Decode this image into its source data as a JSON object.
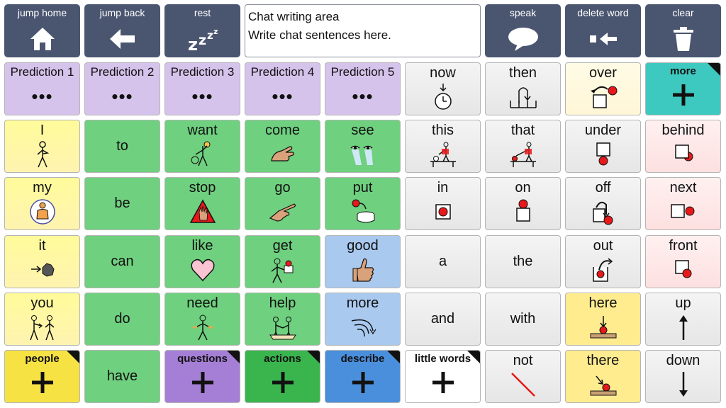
{
  "top": {
    "jump_home": "jump home",
    "jump_back": "jump back",
    "rest": "rest",
    "speak": "speak",
    "delete_word": "delete word",
    "clear": "clear"
  },
  "chat": {
    "title": "Chat writing area",
    "hint": "Write chat sentences here."
  },
  "predictions": [
    "Prediction 1",
    "Prediction 2",
    "Prediction 3",
    "Prediction 4",
    "Prediction 5"
  ],
  "prediction_dots": "•••",
  "words": {
    "now": "now",
    "then": "then",
    "over": "over",
    "more_cat": "more",
    "I": "I",
    "to": "to",
    "want": "want",
    "come": "come",
    "see": "see",
    "this": "this",
    "that": "that",
    "under": "under",
    "behind": "behind",
    "my": "my",
    "be": "be",
    "stop": "stop",
    "go": "go",
    "put": "put",
    "in": "in",
    "on": "on",
    "off": "off",
    "next": "next",
    "it": "it",
    "can": "can",
    "like": "like",
    "get": "get",
    "good": "good",
    "a": "a",
    "the": "the",
    "out": "out",
    "front": "front",
    "you": "you",
    "do": "do",
    "need": "need",
    "help": "help",
    "more": "more",
    "and": "and",
    "with": "with",
    "here": "here",
    "up": "up",
    "have": "have",
    "not": "not",
    "there": "there",
    "down": "down"
  },
  "categories": {
    "people": "people",
    "questions": "questions",
    "actions": "actions",
    "describe": "describe",
    "little_words": "little words"
  },
  "colors": {
    "top_button": "#4a5570",
    "core_yellow": "#fff6a0",
    "verb_green": "#6fd07f",
    "prediction_purple": "#d6c3ec",
    "describe_blue": "#a9c9ef",
    "more_teal": "#3ec9c0",
    "symbol_red": "#e8191a"
  }
}
